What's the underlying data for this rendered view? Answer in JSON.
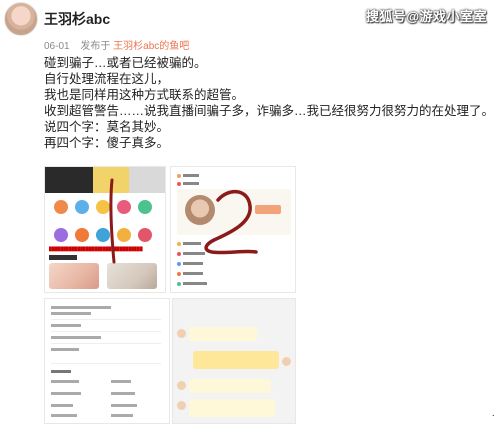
{
  "watermark": "搜狐号@游戏小室室",
  "post": {
    "username": "王羽杉abc",
    "date": "06-01",
    "published_in_prefix": "发布于",
    "published_in_link": "王羽杉abc的鱼吧",
    "lines": [
      "碰到骗子…或者已经被骗的。",
      "自行处理流程在这儿，",
      "我也是同样用这种方式联系的超管。",
      "收到超管警告……说我直播间骗子多，诈骗多…我已经很努力很努力的在处理了。",
      "说四个字：莫名其妙。",
      "再四个字：傻子真多。"
    ]
  },
  "ellipsis": "·",
  "colors": {
    "link": "#eb7350",
    "scribble": "#8b1a1a"
  }
}
